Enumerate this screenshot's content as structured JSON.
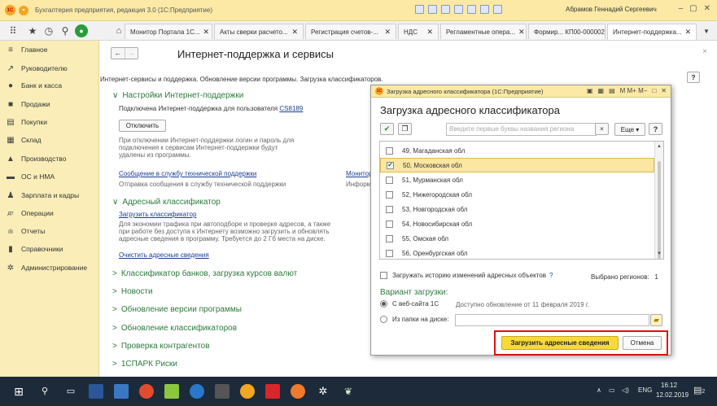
{
  "window": {
    "title": "Бухгалтерия предприятия, редакция 3.0 (1С:Предприятие)",
    "user": "Абрамов Геннадий Сергеевич",
    "min": "–",
    "max": "▢",
    "close": "✕"
  },
  "tabs": [
    {
      "label": "Монитор Портала 1С..."
    },
    {
      "label": "Акты сверки расчето..."
    },
    {
      "label": "Регистрация счетов-..."
    },
    {
      "label": "НДС"
    },
    {
      "label": "Регламентные опера..."
    },
    {
      "label": "Формир... КП00-000002"
    },
    {
      "label": "Интернет-поддержка..."
    }
  ],
  "sidebar": {
    "items": [
      {
        "label": "Главное",
        "icon": "≡"
      },
      {
        "label": "Руководителю",
        "icon": "↗"
      },
      {
        "label": "Банк и касса",
        "icon": "●"
      },
      {
        "label": "Продажи",
        "icon": "■"
      },
      {
        "label": "Покупки",
        "icon": "▤"
      },
      {
        "label": "Склад",
        "icon": "▦"
      },
      {
        "label": "Производство",
        "icon": "▲"
      },
      {
        "label": "ОС и НМА",
        "icon": "▬"
      },
      {
        "label": "Зарплата и кадры",
        "icon": "♟"
      },
      {
        "label": "Операции",
        "icon": "дт"
      },
      {
        "label": "Отчеты",
        "icon": "ılı"
      },
      {
        "label": "Справочники",
        "icon": "▮"
      },
      {
        "label": "Администрирование",
        "icon": "✲"
      }
    ]
  },
  "main": {
    "back": "←",
    "forward": "→",
    "title": "Интернет-поддержка и сервисы",
    "close": "×",
    "help": "?",
    "breadcrumb": "Интернет-сервисы и поддержка. Обновление версии программы. Загрузка классификаторов.",
    "settings": {
      "header": "Настройки Интернет-поддержки",
      "connected_prefix": "Подключена Интернет-поддержка для пользователя",
      "user": "CS8189",
      "disconnect": "Отключить",
      "note_1": "При отключении Интернет-поддержки логин и пароль для",
      "note_2": "подключения к сервисам Интернет-поддержки будут",
      "note_3": "удалены из программы.",
      "support_link": "Сообщение в службу технической поддержки",
      "support_desc": "Отправка сообщения в службу технической поддержки",
      "monitor_link": "Монитор",
      "monitor_desc": "Информ"
    },
    "address": {
      "header": "Адресный классификатор",
      "load_link": "Загрузить классификатор",
      "desc_1": "Для экономии трафика при автоподборе и проверке адресов, а также",
      "desc_2": "при работе без доступа к Интернету возможно загрузить и обновлять",
      "desc_3": "адресные сведения в программу. Требуется до 2 Гб места на диске.",
      "clear_link": "Очистить адресные сведения"
    },
    "groups": [
      "Классификатор банков, загрузка курсов валют",
      "Новости",
      "Обновление версии программы",
      "Обновление классификаторов",
      "Проверка контрагентов",
      "1СПАРК Риски"
    ]
  },
  "dialog": {
    "window_title": "Загрузка адресного классификатора (1С:Предприятие)",
    "heading": "Загрузка адресного классификатора",
    "search_placeholder": "Введите первые буквы названия региона",
    "more": "Еще",
    "help": "?",
    "regions": [
      {
        "label": "49, Магаданская обл",
        "checked": false
      },
      {
        "label": "50, Московская обл",
        "checked": true
      },
      {
        "label": "51, Мурманская обл",
        "checked": false
      },
      {
        "label": "52, Нижегородская обл",
        "checked": false
      },
      {
        "label": "53, Новгородская обл",
        "checked": false
      },
      {
        "label": "54, Новосибирская обл",
        "checked": false
      },
      {
        "label": "55, Омская обл",
        "checked": false
      },
      {
        "label": "56, Оренбургская обл",
        "checked": false
      }
    ],
    "history_label": "Загружать историю изменений адресных объектов",
    "history_help": "?",
    "selected_label": "Выбрано регионов:",
    "selected_count": "1",
    "variant_header": "Вариант загрузки:",
    "option_web": "С веб-сайта 1С",
    "available": "Доступно обновление от 11 февраля 2019 г.",
    "option_disk": "Из папки на диске:",
    "load_btn": "Загрузить адресные сведения",
    "cancel_btn": "Отмена",
    "title_buttons": "M  M+  M−"
  },
  "taskbar": {
    "lang": "ENG",
    "time": "16:12",
    "date": "12.02.2019",
    "notif": "2"
  }
}
